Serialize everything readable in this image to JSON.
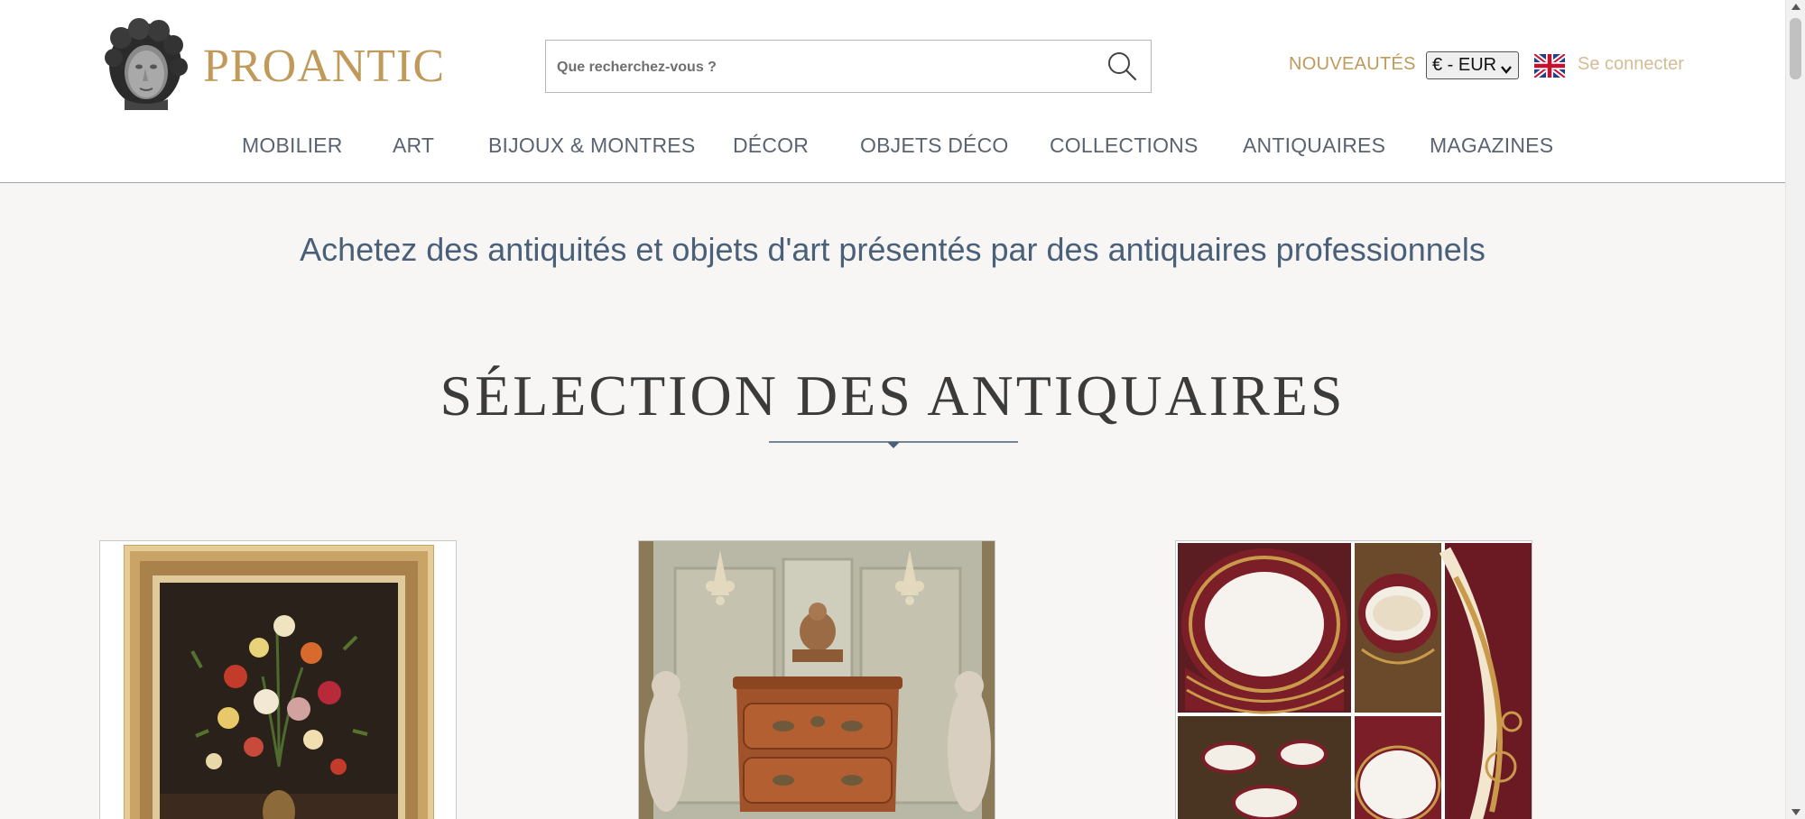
{
  "header": {
    "brand": "PROANTIC",
    "logo_icon": "antique-bust-logo-icon",
    "search": {
      "placeholder": "Que recherchez-vous ?",
      "value": "",
      "icon": "search-icon"
    },
    "new_label": "NOUVEAUTÉS",
    "currency": {
      "selected": "€ - EUR"
    },
    "language_icon": "uk-flag-icon",
    "login_label": "Se connecter"
  },
  "nav": {
    "items": [
      {
        "label": "MOBILIER"
      },
      {
        "label": "ART"
      },
      {
        "label": "BIJOUX & MONTRES"
      },
      {
        "label": "DÉCOR"
      },
      {
        "label": "OBJETS DÉCO"
      },
      {
        "label": "COLLECTIONS"
      },
      {
        "label": "ANTIQUAIRES"
      },
      {
        "label": "MAGAZINES"
      }
    ]
  },
  "hero": {
    "tagline": "Achetez des antiquités et objets d'art présentés par des antiquaires professionnels",
    "section_title": "SÉLECTION DES ANTIQUAIRES"
  },
  "cards": [
    {
      "image": "framed-floral-still-life-painting"
    },
    {
      "image": "louis-xv-commode-with-cherub-statue"
    },
    {
      "image": "red-gilt-porcelain-dinner-service"
    }
  ],
  "colors": {
    "brand_gold": "#bf9a5a",
    "login_gold": "#d4bd94",
    "nav_text": "#5a6470",
    "tagline_blue": "#4a6078",
    "page_bg": "#f7f6f4"
  }
}
